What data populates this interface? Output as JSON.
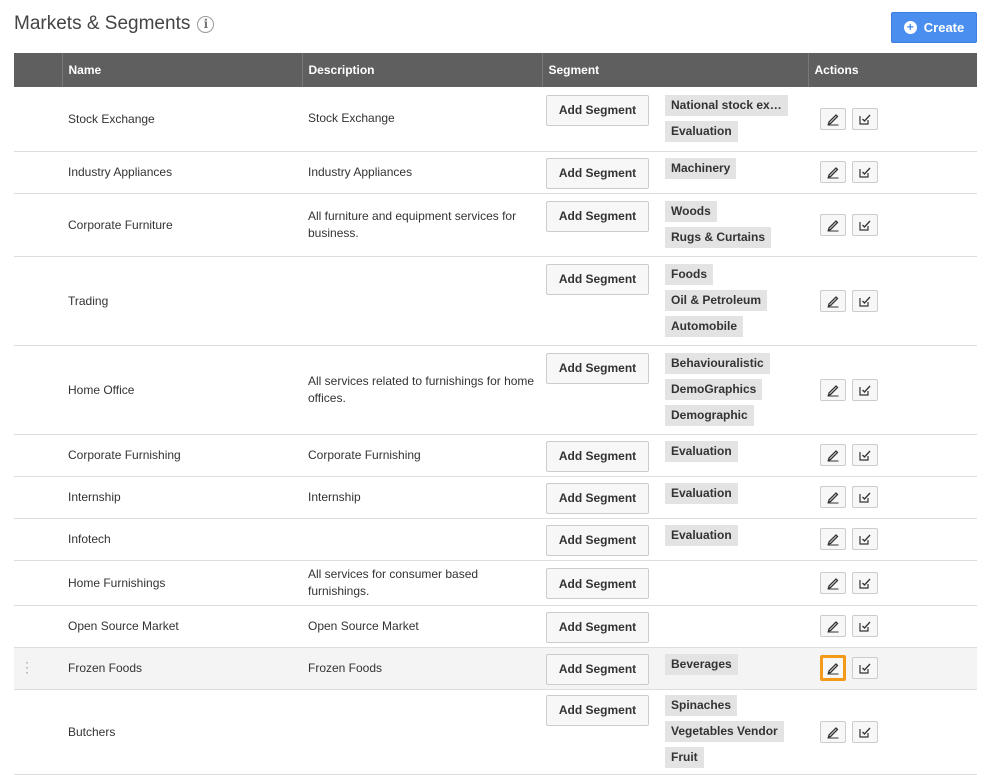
{
  "header": {
    "title": "Markets & Segments",
    "info_icon": "info-icon",
    "create_label": "Create",
    "create_color": "#4a8ef0"
  },
  "table": {
    "columns": [
      "",
      "Name",
      "Description",
      "Segment",
      "Actions"
    ],
    "add_segment_label": "Add Segment",
    "rows": [
      {
        "name": "Stock Exchange",
        "description": "Stock Exchange",
        "segments": [
          "National stock ex…",
          "Evaluation"
        ]
      },
      {
        "name": "Industry Appliances",
        "description": "Industry Appliances",
        "segments": [
          "Machinery"
        ]
      },
      {
        "name": "Corporate Furniture",
        "description": "All furniture and equipment services for business.",
        "segments": [
          "Woods",
          "Rugs & Curtains"
        ]
      },
      {
        "name": "Trading",
        "description": "",
        "segments": [
          "Foods",
          "Oil & Petroleum",
          "Automobile"
        ]
      },
      {
        "name": "Home Office",
        "description": "All services related to furnishings for home offices.",
        "segments": [
          "Behaviouralistic",
          "DemoGraphics",
          "Demographic"
        ]
      },
      {
        "name": "Corporate Furnishing",
        "description": "Corporate Furnishing",
        "segments": [
          "Evaluation"
        ]
      },
      {
        "name": "Internship",
        "description": "Internship",
        "segments": [
          "Evaluation"
        ]
      },
      {
        "name": "Infotech",
        "description": "",
        "segments": [
          "Evaluation"
        ]
      },
      {
        "name": "Home Furnishings",
        "description": "All services for consumer based furnishings.",
        "segments": []
      },
      {
        "name": "Open Source Market",
        "description": "Open Source Market",
        "segments": []
      },
      {
        "name": "Frozen Foods",
        "description": "Frozen Foods",
        "segments": [
          "Beverages"
        ],
        "highlighted": true
      },
      {
        "name": "Butchers",
        "description": "",
        "segments": [
          "Spinaches",
          "Vegetables Vendor",
          "Fruit"
        ]
      }
    ]
  },
  "icons": {
    "edit": "pencil-icon",
    "assign": "checkbox-arrow-icon",
    "drag": "drag-handle-icon"
  },
  "colors": {
    "header_bg": "#5f5f5f",
    "selected_outline": "#f39a1a"
  }
}
